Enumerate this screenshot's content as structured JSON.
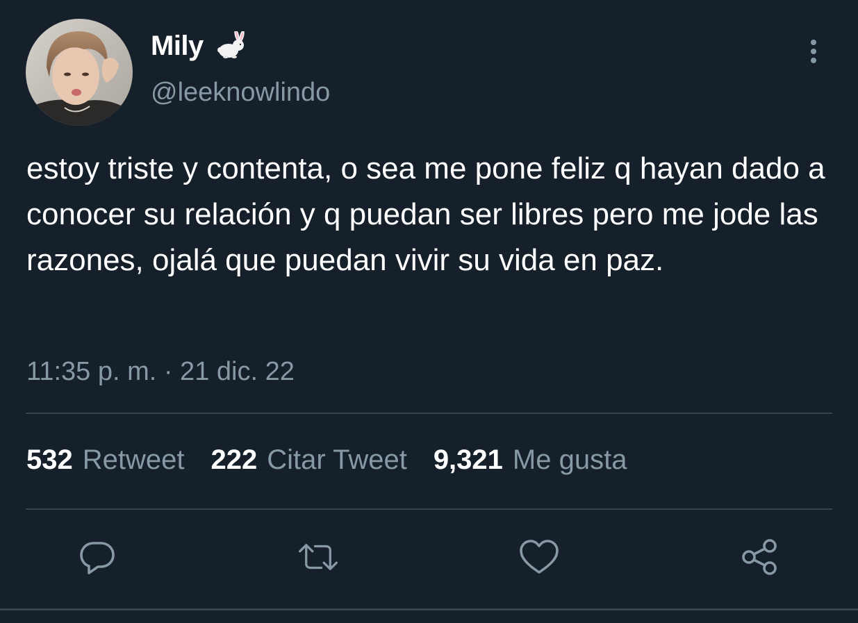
{
  "user": {
    "display_name": "Mily",
    "name_emoji": "rabbit-icon",
    "handle": "@leeknowlindo"
  },
  "tweet": {
    "text": "estoy triste y contenta, o sea me pone feliz q hayan dado a conocer su relación y q puedan ser libres pero me jode las razones, ojalá que puedan vivir su vida en paz.",
    "timestamp": "11:35 p. m. · 21 dic. 22"
  },
  "stats": {
    "retweets": {
      "count": "532",
      "label": "Retweet"
    },
    "quotes": {
      "count": "222",
      "label": "Citar Tweet"
    },
    "likes": {
      "count": "9,321",
      "label": "Me gusta"
    }
  },
  "actions": [
    "reply-icon",
    "retweet-icon",
    "like-icon",
    "share-icon"
  ],
  "colors": {
    "background": "#15202b",
    "primary_text": "#ffffff",
    "secondary_text": "#8899a6",
    "divider": "#38444d"
  }
}
